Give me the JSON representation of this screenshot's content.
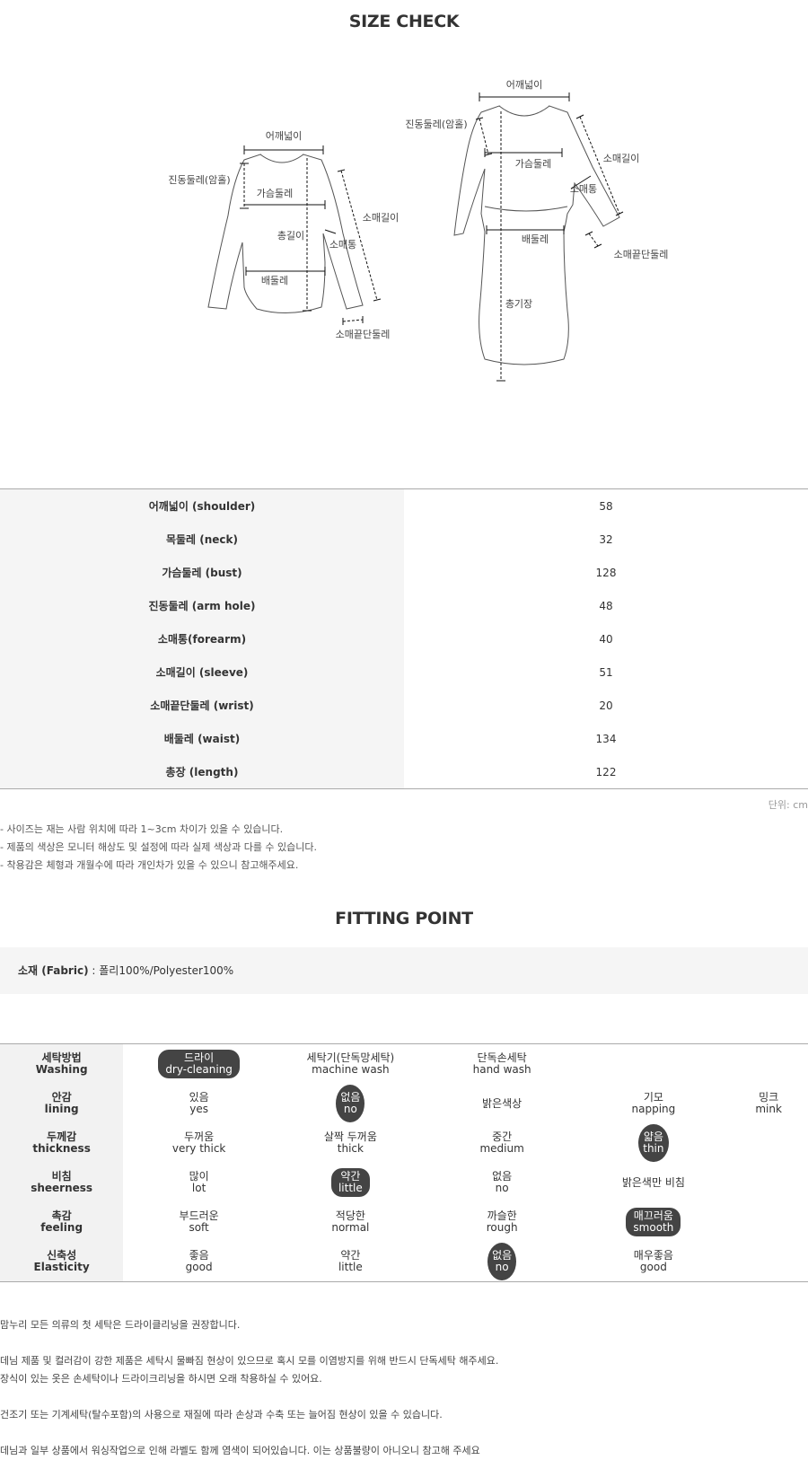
{
  "size_check": {
    "title": "SIZE CHECK",
    "diagram_labels": {
      "top_shoulder": "어깨넓이",
      "top_armhole": "진동둘레(암홀)",
      "top_bust": "가슴둘레",
      "top_length": "총길이",
      "top_forearm": "소매통",
      "top_sleeve": "소매길이",
      "top_waist": "배둘레",
      "top_wrist": "소매끝단둘레",
      "dress_shoulder": "어깨넓이",
      "dress_armhole": "진동둘레(암홀)",
      "dress_bust": "가슴둘레",
      "dress_sleeve": "소매길이",
      "dress_forearm": "소매통",
      "dress_waist": "배둘레",
      "dress_wrist": "소매끝단둘레",
      "dress_length": "총기장"
    },
    "rows": [
      {
        "label": "어깨넓이 (shoulder)",
        "value": "58"
      },
      {
        "label": "목둘레 (neck)",
        "value": "32"
      },
      {
        "label": "가슴둘레 (bust)",
        "value": "128"
      },
      {
        "label": "진동둘레 (arm hole)",
        "value": "48"
      },
      {
        "label": "소매통(forearm)",
        "value": "40"
      },
      {
        "label": "소매길이 (sleeve)",
        "value": "51"
      },
      {
        "label": "소매끝단둘레 (wrist)",
        "value": "20"
      },
      {
        "label": "배둘레 (waist)",
        "value": "134"
      },
      {
        "label": "총장 (length)",
        "value": "122"
      }
    ],
    "unit": "단위: cm",
    "notes": [
      "- 사이즈는 재는 사람 위치에 따라 1~3cm 차이가 있을 수 있습니다.",
      "- 제품의 색상은 모니터 해상도 및 설정에 따라 실제 색상과 다를 수 있습니다.",
      "- 착용감은 체형과 개월수에 따라 개인차가 있을 수 있으니 참고해주세요."
    ]
  },
  "fitting_point": {
    "title": "FITTING POINT",
    "fabric_label": "소재 (Fabric)",
    "fabric_value": " : 폴리100%/Polyester100%",
    "rows": [
      {
        "ko": "세탁방법",
        "en": "Washing",
        "options": [
          {
            "ko": "드라이",
            "en": "dry-cleaning",
            "selected": true
          },
          {
            "ko": "세탁기(단독망세탁)",
            "en": "machine wash",
            "selected": false
          },
          {
            "ko": "단독손세탁",
            "en": "hand wash",
            "selected": false
          },
          {
            "ko": "",
            "en": "",
            "selected": false
          },
          {
            "ko": "",
            "en": "",
            "selected": false
          }
        ]
      },
      {
        "ko": "안감",
        "en": "lining",
        "options": [
          {
            "ko": "있음",
            "en": "yes",
            "selected": false
          },
          {
            "ko": "없음",
            "en": "no",
            "selected": true
          },
          {
            "ko": "밝은색상",
            "en": "",
            "selected": false
          },
          {
            "ko": "기모",
            "en": "napping",
            "selected": false
          },
          {
            "ko": "밍크",
            "en": "mink",
            "selected": false
          }
        ]
      },
      {
        "ko": "두께감",
        "en": "thickness",
        "options": [
          {
            "ko": "두꺼움",
            "en": "very thick",
            "selected": false
          },
          {
            "ko": "살짝 두꺼움",
            "en": "thick",
            "selected": false
          },
          {
            "ko": "중간",
            "en": "medium",
            "selected": false
          },
          {
            "ko": "얇음",
            "en": "thin",
            "selected": true
          },
          {
            "ko": "",
            "en": "",
            "selected": false
          }
        ]
      },
      {
        "ko": "비침",
        "en": "sheerness",
        "options": [
          {
            "ko": "많이",
            "en": "lot",
            "selected": false
          },
          {
            "ko": "약간",
            "en": "little",
            "selected": true
          },
          {
            "ko": "없음",
            "en": "no",
            "selected": false
          },
          {
            "ko": "밝은색만 비침",
            "en": "",
            "selected": false
          },
          {
            "ko": "",
            "en": "",
            "selected": false
          }
        ]
      },
      {
        "ko": "촉감",
        "en": "feeling",
        "options": [
          {
            "ko": "부드러운",
            "en": "soft",
            "selected": false
          },
          {
            "ko": "적당한",
            "en": "normal",
            "selected": false
          },
          {
            "ko": "까슬한",
            "en": "rough",
            "selected": false
          },
          {
            "ko": "매끄러움",
            "en": "smooth",
            "selected": true
          },
          {
            "ko": "",
            "en": "",
            "selected": false
          }
        ]
      },
      {
        "ko": "신축성",
        "en": "Elasticity",
        "options": [
          {
            "ko": "좋음",
            "en": "good",
            "selected": false
          },
          {
            "ko": "약간",
            "en": "little",
            "selected": false
          },
          {
            "ko": "없음",
            "en": "no",
            "selected": true
          },
          {
            "ko": "매우좋음",
            "en": "good",
            "selected": false
          },
          {
            "ko": "",
            "en": "",
            "selected": false
          }
        ]
      }
    ],
    "care_notes": [
      "맘누리 모든 의류의 첫 세탁은 드라이클리닝을 권장합니다.",
      "",
      "데님 제품 및 컬러감이 강한 제품은 세탁시 물빠짐 현상이 있으므로 혹시 모를 이염방지를 위해 반드시 단독세탁 해주세요.",
      "장식이 있는 옷은 손세탁이나 드라이크리닝을 하시면 오래 착용하실 수 있어요.",
      "",
      "건조기 또는 기계세탁(탈수포함)의 사용으로 재질에 따라 손상과 수축 또는 늘어짐 현상이 있을 수 있습니다.",
      "",
      "데님과 일부 상품에서 워싱작업으로 인해 라벨도 함께 염색이 되어있습니다. 이는 상품불량이 아니오니 참고해 주세요"
    ]
  }
}
